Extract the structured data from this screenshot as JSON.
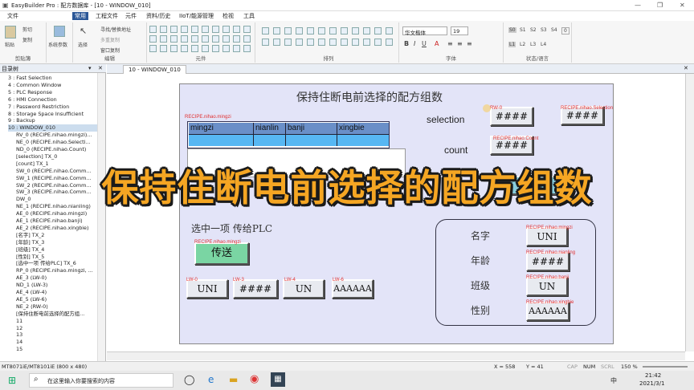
{
  "app": {
    "title": "EasyBuilder Pro : 配方数据库 - [10 - WINDOW_010]"
  },
  "menu": [
    "文件",
    "常用",
    "工程文件",
    "元件",
    "资料/历史",
    "IIoT/能源管理",
    "检视",
    "工具"
  ],
  "ribbon": {
    "clipboard": {
      "paste": "粘贴",
      "cut": "剪切",
      "copy": "复制",
      "label": "剪贴簿"
    },
    "system_params": "系统参数",
    "edit": {
      "select": "选择",
      "find_replace": "寻找/替换地址",
      "multi_copy": "多重复制",
      "window_copy": "窗口复制",
      "label": "编辑"
    },
    "elements_label": "元件",
    "arrange_label": "排列",
    "font": {
      "name": "华文楷体",
      "size": "19",
      "label": "字体"
    },
    "state": {
      "s0": "S0",
      "s1": "S1",
      "s2": "S2",
      "s3": "S3",
      "s4": "S4",
      "l1": "L1",
      "l2": "L2",
      "l3": "L3",
      "l4": "L4",
      "value": "0",
      "label": "状态/语言"
    }
  },
  "tree": {
    "header": "目录树",
    "items": [
      "3 : Fast Selection",
      "4 : Common Window",
      "5 : PLC Response",
      "6 : HMI Connection",
      "7 : Password Restriction",
      "8 : Storage Space Insufficient",
      "9 : Backup",
      "10 : WINDOW_010",
      "RV_0 (RECIPE.nihao.mingzi)...",
      "NE_0 (RECIPE.nihao.Selecti...",
      "ND_0 (RECIPE.nihao.Count)",
      "[selection] TX_0",
      "[count] TX_1",
      "SW_0 (RECIPE.nihao.Comm...",
      "SW_1 (RECIPE.nihao.Comm...",
      "SW_2 (RECIPE.nihao.Comm...",
      "SW_3 (RECIPE.nihao.Comm...",
      "DW_0",
      "NE_1 (RECIPE.nihao.nianling)",
      "AE_0 (RECIPE.nihao.mingzi)",
      "AE_1 (RECIPE.nihao.banji)",
      "AE_2 (RECIPE.nihao.xingbie)",
      "[名字] TX_2",
      "[年龄] TX_3",
      "[班级] TX_4",
      "[性别] TX_5",
      "[选中一项 传给PLC] TX_6",
      "RP_0 (RECIPE.nihao.mingzi, ...",
      "AE_3 (LW-0)",
      "ND_1 (LW-3)",
      "AE_4 (LW-4)",
      "AE_5 (LW-6)",
      "NE_2 (RW-0)",
      "[保持住断电前选择的配方组...",
      "11",
      "12",
      "13",
      "14",
      "15"
    ]
  },
  "tab": "10 - WINDOW_010",
  "hmi": {
    "title": "保持住断电前选择的配方组数",
    "grid_tag": "RECIPE.nihao.mingzi",
    "columns": [
      "mingzi",
      "nianlin",
      "banji",
      "xingbie"
    ],
    "selection_label": "selection",
    "count_label": "count",
    "rw0_tag": "RW-0",
    "rw0_value": "####",
    "sel_tag": "RECIPE.nihao.Selection",
    "sel_value": "####",
    "count_tag": "RECIPE.nihao.Count",
    "count_value": "####",
    "partial_btn": "前",
    "pick_label": "选中一项  传给PLC",
    "send_tag": "RECIPE.nihao.mingzi",
    "send_btn": "传送",
    "lw": [
      {
        "tag": "LW-0",
        "value": "UNI"
      },
      {
        "tag": "LW-3",
        "value": "####"
      },
      {
        "tag": "LW-4",
        "value": "UN"
      },
      {
        "tag": "LW-6",
        "value": "AAAAAA"
      }
    ],
    "fields": [
      {
        "label": "名字",
        "tag": "RECIPE.nihao.mingzi",
        "value": "UNI"
      },
      {
        "label": "年龄",
        "tag": "RECIPE.nihao.nianling",
        "value": "####"
      },
      {
        "label": "班级",
        "tag": "RECIPE.nihao.banji",
        "value": "UN"
      },
      {
        "label": "性别",
        "tag": "RECIPE.nihao.xingbie",
        "value": "AAAAAA"
      }
    ]
  },
  "overlay": "保持住断电前选择的配方组数",
  "status": {
    "model": "MT8071iE/MT8101iE (800 x 480)",
    "x": "X = 558",
    "y": "Y = 41",
    "cap": "CAP",
    "num": "NUM",
    "scrl": "SCRL",
    "zoom": "150 %"
  },
  "taskbar": {
    "search_placeholder": "在这里输入你要搜索的内容",
    "time": "21:42",
    "date": "2021/3/1",
    "ime": "中"
  }
}
